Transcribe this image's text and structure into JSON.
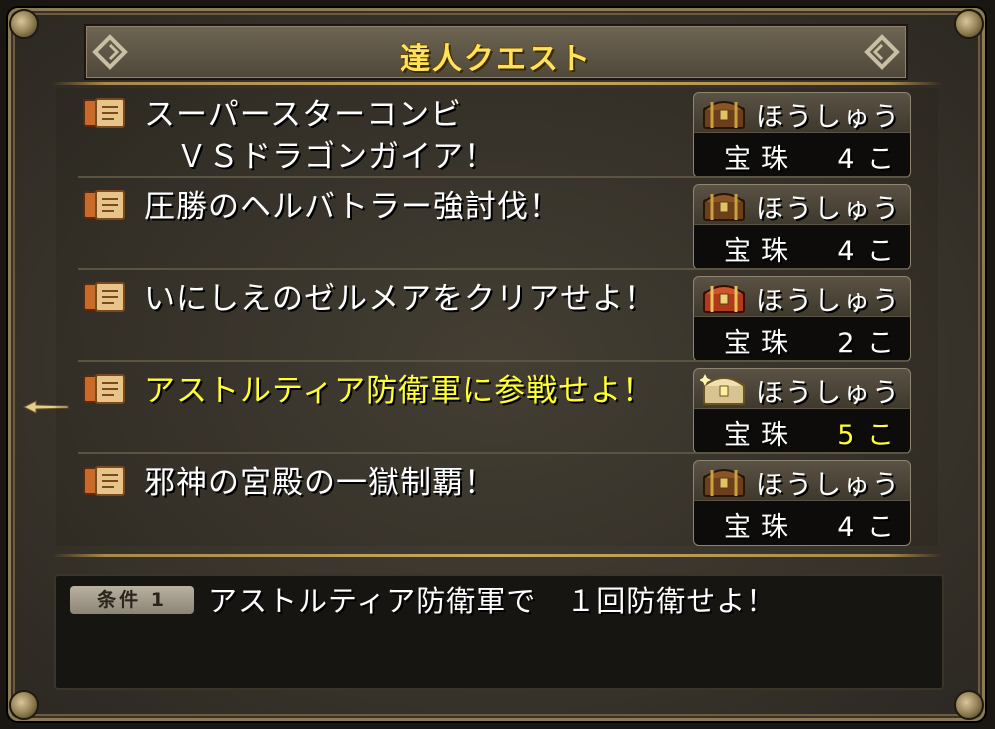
{
  "window": {
    "title": "達人クエスト"
  },
  "quests": [
    {
      "title": "スーパースターコンビ\n　ＶＳドラゴンガイア！",
      "reward_label": "ほうしゅう",
      "reward_item": "宝珠",
      "reward_count": "4 こ",
      "chest": "brown-chest-icon",
      "selected": false
    },
    {
      "title": "圧勝のヘルバトラー強討伐！",
      "reward_label": "ほうしゅう",
      "reward_item": "宝珠",
      "reward_count": "4 こ",
      "chest": "brown-chest-icon",
      "selected": false
    },
    {
      "title": "いにしえのゼルメアをクリアせよ！",
      "reward_label": "ほうしゅう",
      "reward_item": "宝珠",
      "reward_count": "2 こ",
      "chest": "red-chest-icon",
      "selected": false
    },
    {
      "title": "アストルティア防衛軍に参戦せよ！",
      "reward_label": "ほうしゅう",
      "reward_item": "宝珠",
      "reward_count": "5 こ",
      "chest": "gold-chest-icon",
      "selected": true
    },
    {
      "title": "邪神の宮殿の一獄制覇！",
      "reward_label": "ほうしゅう",
      "reward_item": "宝珠",
      "reward_count": "4 こ",
      "chest": "brown-chest-icon",
      "selected": false
    }
  ],
  "condition": {
    "badge": "条件 1",
    "text": "アストルティア防衛軍で　１回防衛せよ！"
  },
  "colors": {
    "title_yellow": "#ffe15a",
    "selected_yellow": "#ffff33",
    "frame_gold": "#c9a95f"
  }
}
